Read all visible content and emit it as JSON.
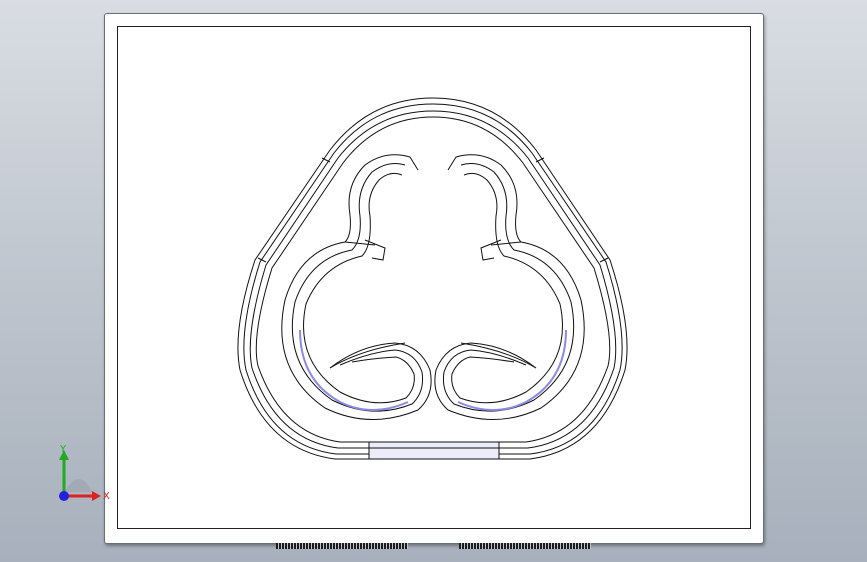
{
  "viewport": {
    "background": "gradient-grey"
  },
  "triad": {
    "y_label": "Y",
    "x_label": "X",
    "y_color": "#22aa22",
    "x_color": "#dd2222",
    "z_color": "#2222dd"
  },
  "model": {
    "line_color": "#111111",
    "highlight_color": "#8a8ae6"
  }
}
